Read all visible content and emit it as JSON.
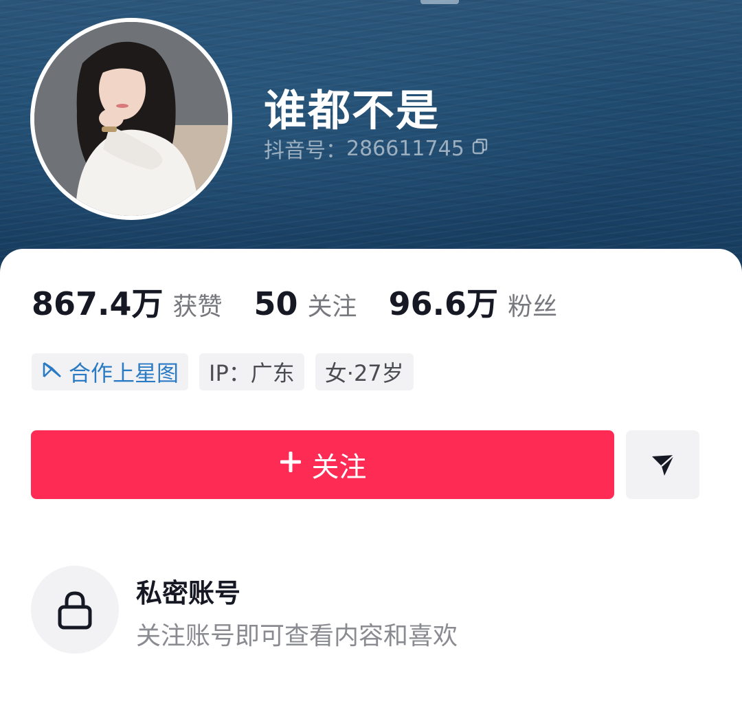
{
  "profile": {
    "nickname": "谁都不是",
    "id_label": "抖音号：",
    "id_value": "286611745",
    "avatar_icon": "user-photo"
  },
  "stats": [
    {
      "value": "867.4万",
      "label": "获赞"
    },
    {
      "value": "50",
      "label": "关注"
    },
    {
      "value": "96.6万",
      "label": "粉丝"
    }
  ],
  "tags": {
    "star": "合作上星图",
    "ip": "IP：广东",
    "gender_age": "女·27岁"
  },
  "actions": {
    "follow_label": "关注",
    "follow_icon": "plus-icon",
    "share_icon": "paper-plane-icon"
  },
  "private": {
    "title": "私密账号",
    "desc": "关注账号即可查看内容和喜欢",
    "icon": "lock-icon"
  },
  "colors": {
    "accent": "#fe2c55",
    "star_tag": "#2a7bc4",
    "cover": "#1f4a6e",
    "text_primary": "#161823",
    "text_secondary": "#77787d"
  }
}
